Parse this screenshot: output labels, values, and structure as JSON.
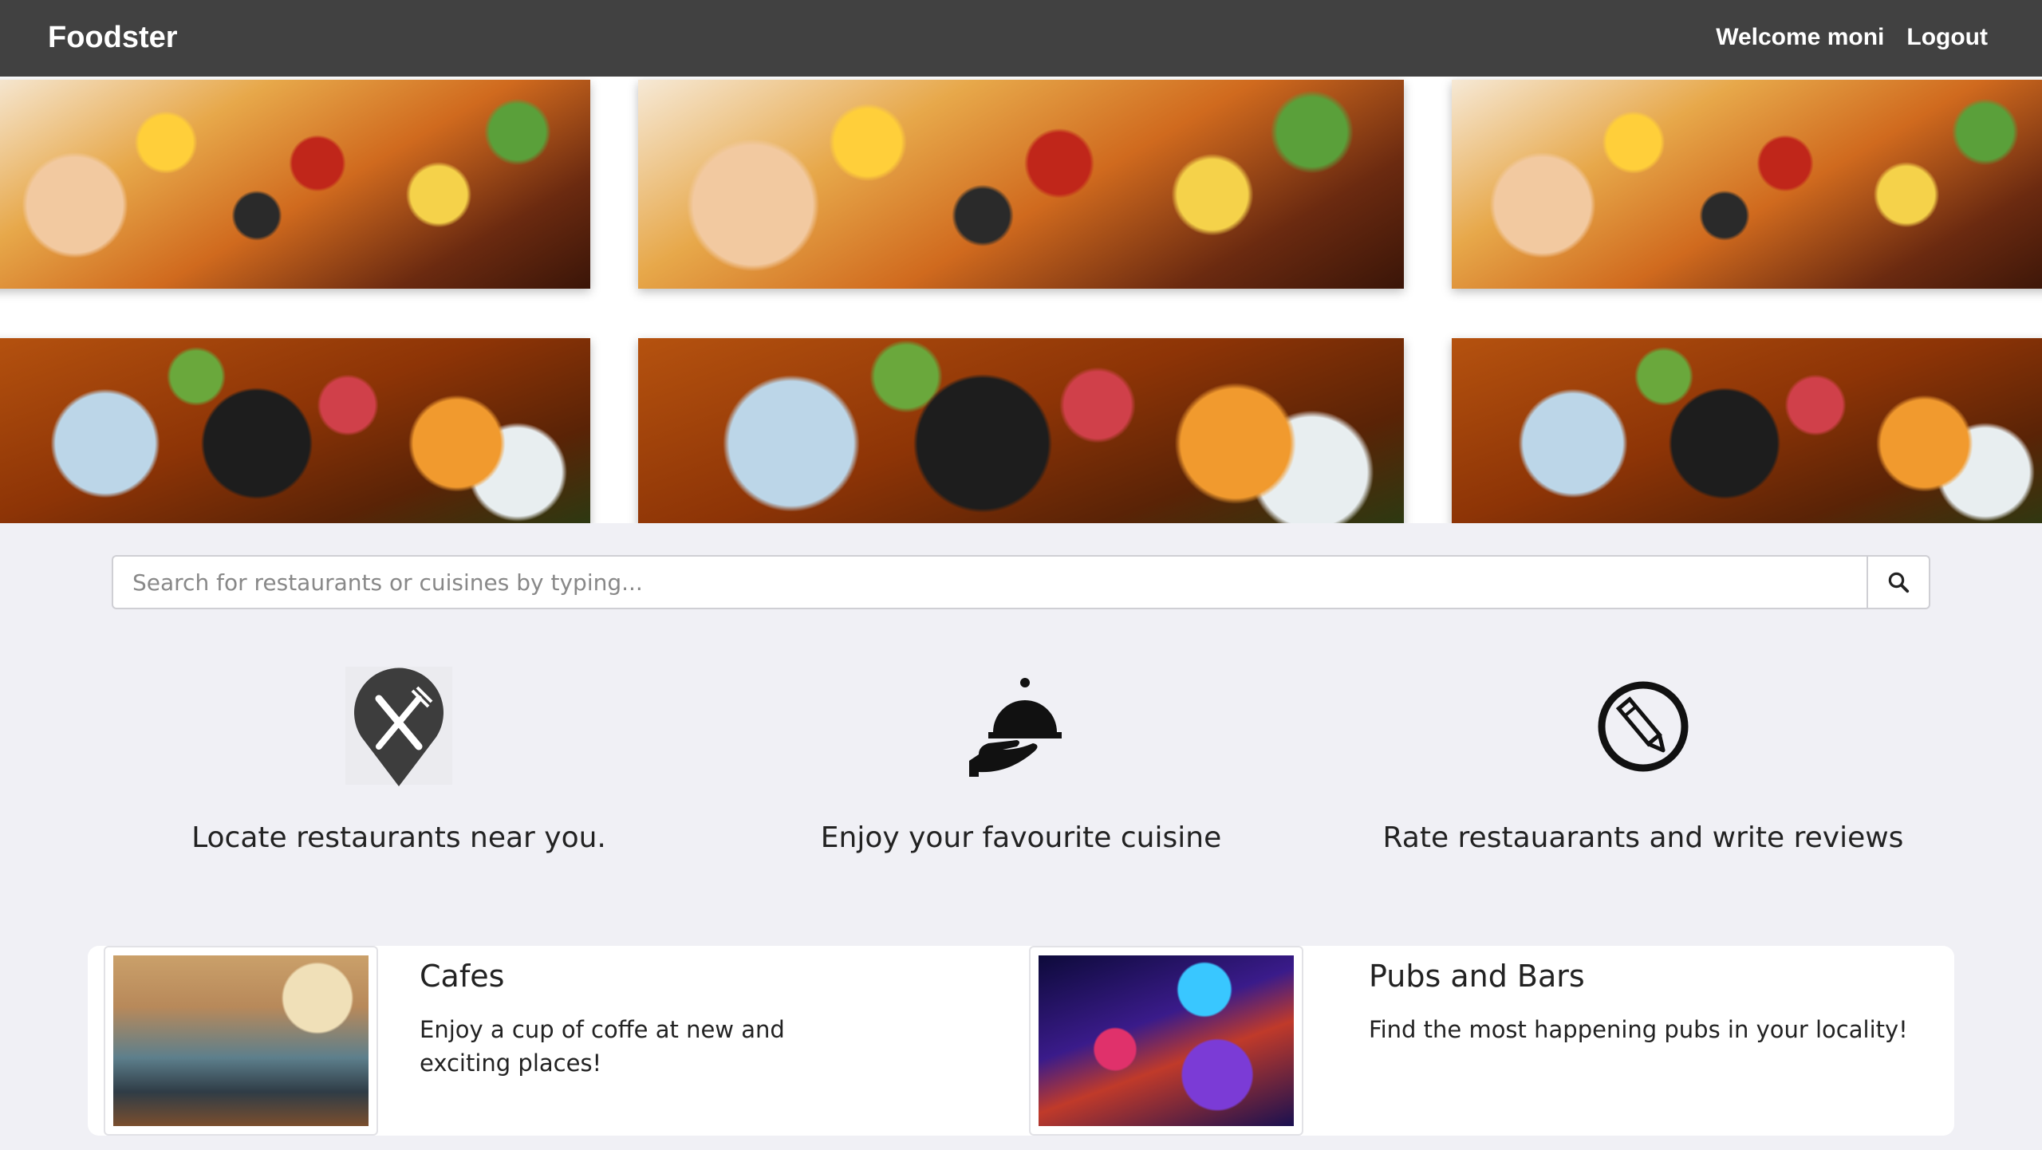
{
  "navbar": {
    "brand": "Foodster",
    "welcome": "Welcome moni",
    "logout": "Logout"
  },
  "hero": {
    "tiles": [
      "sushi-platter",
      "sushi-platter",
      "sushi-platter",
      "hot-pot",
      "hot-pot",
      "hot-pot"
    ]
  },
  "search": {
    "placeholder": "Search for restaurants or cuisines by typing...",
    "value": "",
    "icon": "search-icon"
  },
  "features": [
    {
      "icon": "location-pin-cutlery-icon",
      "label": "Locate restaurants near you."
    },
    {
      "icon": "serving-cloche-icon",
      "label": "Enjoy your favourite cuisine"
    },
    {
      "icon": "pencil-circle-icon",
      "label": "Rate restauarants and write reviews"
    }
  ],
  "cards": [
    {
      "title": "Cafes",
      "description": "Enjoy a cup of coffe at new and exciting places!"
    },
    {
      "title": "Pubs and Bars",
      "description": "Find the most happening pubs in your locality!"
    }
  ],
  "colors": {
    "navbar": "#414141",
    "page_background": "#f0f0f5",
    "text": "#222222"
  }
}
